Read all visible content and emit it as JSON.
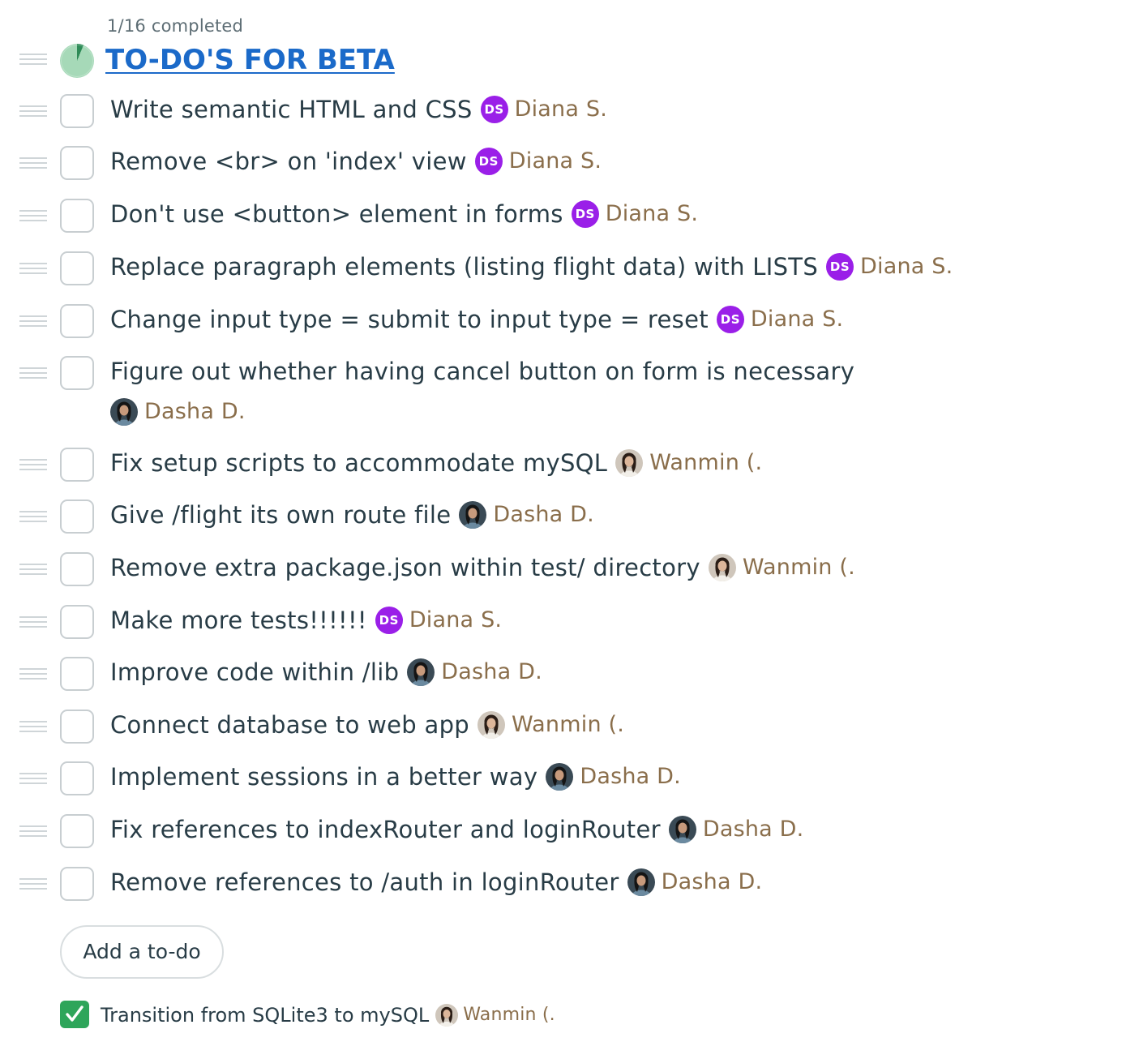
{
  "list": {
    "progress_text": "1/16 completed",
    "title": "TO-DO'S FOR BETA",
    "progress_fraction": 0.0625
  },
  "todos": [
    {
      "text": "Write semantic HTML and CSS",
      "assignee": "Diana S.",
      "avatar": "DS",
      "avatar_type": "initials"
    },
    {
      "text": "Remove <br> on 'index' view",
      "assignee": "Diana S.",
      "avatar": "DS",
      "avatar_type": "initials"
    },
    {
      "text": "Don't use <button> element in forms",
      "assignee": "Diana S.",
      "avatar": "DS",
      "avatar_type": "initials"
    },
    {
      "text": "Replace paragraph elements (listing flight data) with LISTS",
      "assignee": "Diana S.",
      "avatar": "DS",
      "avatar_type": "initials"
    },
    {
      "text": "Change input type = submit to input type = reset",
      "assignee": "Diana S.",
      "avatar": "DS",
      "avatar_type": "initials"
    },
    {
      "text": "Figure out whether having cancel button on form is necessary",
      "assignee": "Dasha D.",
      "avatar": "photo-dasha",
      "avatar_type": "photo"
    },
    {
      "text": "Fix setup scripts to accommodate mySQL",
      "assignee": "Wanmin (.",
      "avatar": "photo-wanmin",
      "avatar_type": "photo"
    },
    {
      "text": "Give /flight its own route file",
      "assignee": "Dasha D.",
      "avatar": "photo-dasha",
      "avatar_type": "photo"
    },
    {
      "text": "Remove extra package.json within test/ directory",
      "assignee": "Wanmin (.",
      "avatar": "photo-wanmin",
      "avatar_type": "photo"
    },
    {
      "text": "Make more tests!!!!!!",
      "assignee": "Diana S.",
      "avatar": "DS",
      "avatar_type": "initials"
    },
    {
      "text": "Improve code within /lib",
      "assignee": "Dasha D.",
      "avatar": "photo-dasha",
      "avatar_type": "photo"
    },
    {
      "text": "Connect database to web app",
      "assignee": "Wanmin (.",
      "avatar": "photo-wanmin",
      "avatar_type": "photo"
    },
    {
      "text": "Implement sessions in a better way",
      "assignee": "Dasha D.",
      "avatar": "photo-dasha",
      "avatar_type": "photo"
    },
    {
      "text": "Fix references to indexRouter and loginRouter",
      "assignee": "Dasha D.",
      "avatar": "photo-dasha",
      "avatar_type": "photo"
    },
    {
      "text": "Remove references to /auth in loginRouter",
      "assignee": "Dasha D.",
      "avatar": "photo-dasha",
      "avatar_type": "photo"
    }
  ],
  "add_button": {
    "label": "Add a to-do"
  },
  "completed": [
    {
      "text": "Transition from SQLite3 to mySQL",
      "assignee": "Wanmin (.",
      "avatar": "photo-wanmin",
      "avatar_type": "photo"
    }
  ],
  "colors": {
    "title_link": "#1b6ac9",
    "initials_avatar": "#9a1fe8",
    "assignee_name": "#8a6e4b",
    "checked_box": "#2ea55a",
    "pie_fill": "#a6d9b8",
    "pie_done": "#2e8b57"
  },
  "icons": {
    "drag_handle": "drag-handle-icon",
    "progress": "progress-pie-icon",
    "checkmark": "checkmark-icon"
  }
}
